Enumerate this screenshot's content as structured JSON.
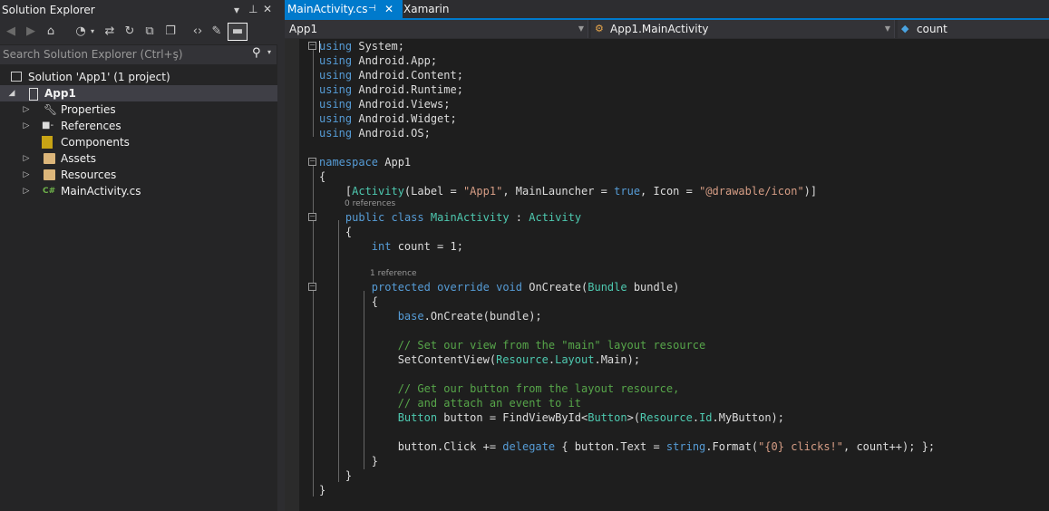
{
  "solution_explorer": {
    "title": "Solution Explorer",
    "search_placeholder": "Search Solution Explorer (Ctrl+ş)",
    "tree": [
      {
        "label": "Solution 'App1' (1 project)",
        "icon": "solution-icon"
      },
      {
        "label": "App1",
        "icon": "android-project-icon",
        "expanded": true,
        "selected": true
      },
      {
        "label": "Properties",
        "icon": "wrench-icon"
      },
      {
        "label": "References",
        "icon": "references-icon"
      },
      {
        "label": "Components",
        "icon": "components-icon"
      },
      {
        "label": "Assets",
        "icon": "folder-icon"
      },
      {
        "label": "Resources",
        "icon": "folder-icon"
      },
      {
        "label": "MainActivity.cs",
        "icon": "csharp-file-icon",
        "badge": "C#"
      }
    ]
  },
  "tabs": [
    {
      "label": "MainActivity.cs",
      "active": true
    },
    {
      "label": "Xamarin",
      "active": false
    }
  ],
  "navbar": {
    "project": "App1",
    "type": "App1.MainActivity",
    "member": "count"
  },
  "code": {
    "l1": [
      "using",
      " System;"
    ],
    "l2": [
      "using",
      " Android.App;"
    ],
    "l3": [
      "using",
      " Android.Content;"
    ],
    "l4": [
      "using",
      " Android.Runtime;"
    ],
    "l5": [
      "using",
      " Android.Views;"
    ],
    "l6": [
      "using",
      " Android.Widget;"
    ],
    "l7": [
      "using",
      " Android.OS;"
    ],
    "l9": [
      "namespace",
      " App1"
    ],
    "l10": "{",
    "l11": [
      "    [",
      "Activity",
      "(Label = ",
      "\"App1\"",
      ", MainLauncher = ",
      "true",
      ", Icon = ",
      "\"@drawable/icon\"",
      ")]"
    ],
    "lens1": "0 references",
    "l12": [
      "    ",
      "public",
      " ",
      "class",
      " ",
      "MainActivity",
      " : ",
      "Activity"
    ],
    "l13": "    {",
    "l14": [
      "        ",
      "int",
      " count = 1;"
    ],
    "lens2": "1 reference",
    "l16": [
      "        ",
      "protected",
      " ",
      "override",
      " ",
      "void",
      " OnCreate(",
      "Bundle",
      " bundle)"
    ],
    "l17": "        {",
    "l18": [
      "            ",
      "base",
      ".OnCreate(bundle);"
    ],
    "l20": "            // Set our view from the \"main\" layout resource",
    "l21": [
      "            SetContentView(",
      "Resource",
      ".",
      "Layout",
      ".Main);"
    ],
    "l23": "            // Get our button from the layout resource,",
    "l24": "            // and attach an event to it",
    "l25": [
      "            ",
      "Button",
      " button = FindViewById<",
      "Button",
      ">(",
      "Resource",
      ".",
      "Id",
      ".MyButton);"
    ],
    "l27": [
      "            button.Click += ",
      "delegate",
      " { button.Text = ",
      "string",
      ".Format(",
      "\"{0} clicks!\"",
      ", count++); };"
    ],
    "l28": "        }",
    "l29": "    }",
    "l30": "}"
  },
  "colors": {
    "accent": "#007acc",
    "keyword": "#569cd6",
    "type": "#4ec9b0",
    "string": "#d69d85",
    "comment": "#57a64a"
  }
}
